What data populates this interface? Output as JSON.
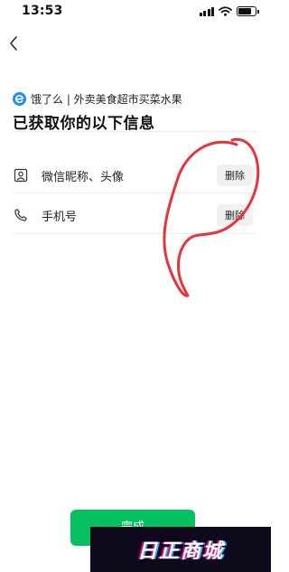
{
  "status_bar": {
    "time": "13:53",
    "icons": [
      "signal-icon",
      "wifi-icon",
      "battery-icon"
    ]
  },
  "nav": {
    "back_icon": "chevron-left-icon"
  },
  "app": {
    "logo_icon": "eleme-logo-icon",
    "name": "饿了么 | 外卖美食超市买菜水果",
    "brand_color": "#1e90f0"
  },
  "page": {
    "title": "已获取你的以下信息"
  },
  "permissions": [
    {
      "icon": "profile-card-icon",
      "label": "微信昵称、头像",
      "action": "删除"
    },
    {
      "icon": "phone-icon",
      "label": "手机号",
      "action": "删除"
    }
  ],
  "footer": {
    "done_label": "完成",
    "accent_color": "#07c160"
  },
  "annotation": {
    "scribble_color": "#e8333a"
  },
  "watermark": {
    "text": "日正商城"
  }
}
